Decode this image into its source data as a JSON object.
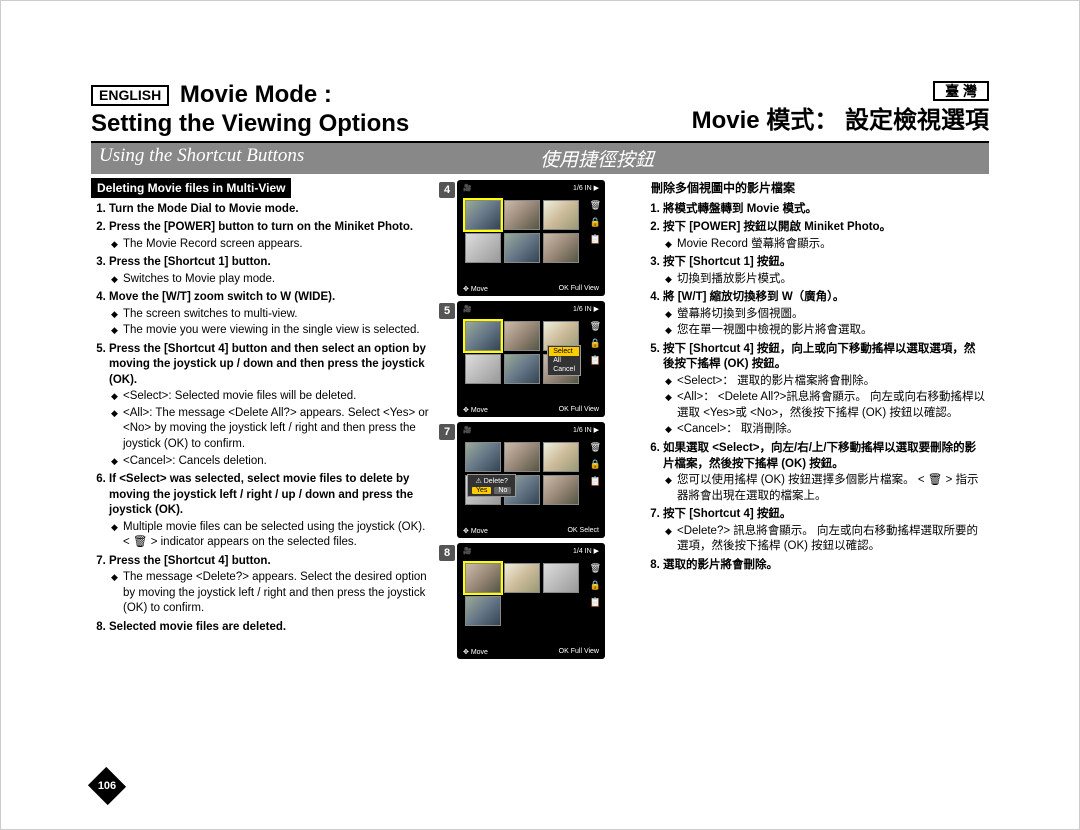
{
  "lang_badge_en": "ENGLISH",
  "lang_badge_tw": "臺 灣",
  "title_en_1": "Movie Mode :",
  "title_en_2": "Setting the Viewing Options",
  "title_zh": "Movie 模式： 設定檢視選項",
  "section_en": "Using the Shortcut Buttons",
  "section_zh": "使用捷徑按鈕",
  "subhead_en": "Deleting Movie files in Multi-View",
  "subhead_zh": "刪除多個視圖中的影片檔案",
  "page_number": "106",
  "screens": {
    "counter": "1/6",
    "media": "IN",
    "move": "Move",
    "fullview": "Full View",
    "select": "Select",
    "delete_q": "Delete?",
    "yes": "Yes",
    "no": "No",
    "popup": {
      "select": "Select",
      "all": "All",
      "cancel": "Cancel"
    }
  },
  "en": {
    "s1": "Turn the Mode Dial to Movie mode.",
    "s2": "Press the [POWER] button to turn on the Miniket Photo.",
    "s2a": "The Movie Record screen appears.",
    "s3": "Press the [Shortcut 1] button.",
    "s3a": "Switches to Movie play mode.",
    "s4": "Move the [W/T] zoom switch to W (WIDE).",
    "s4a": "The screen switches to multi-view.",
    "s4b": "The movie you were viewing in the single view is selected.",
    "s5": "Press the [Shortcut 4] button and then select an option by moving the joystick up / down and then press the joystick (OK).",
    "s5a": "<Select>: Selected movie files will be deleted.",
    "s5b": "<All>: The message <Delete All?> appears. Select <Yes> or <No> by moving the joystick left / right and then press the joystick (OK) to confirm.",
    "s5c": "<Cancel>: Cancels deletion.",
    "s6": "If <Select> was selected, select movie files to delete by moving the joystick left / right / up / down and press the joystick (OK).",
    "s6a": "Multiple movie files can be selected using the joystick (OK). < 🗑 > indicator appears on the selected files.",
    "s7": "Press the [Shortcut 4] button.",
    "s7a": "The message <Delete?> appears. Select the desired option by moving the joystick left / right and then press the joystick (OK) to confirm.",
    "s8": "Selected movie files are deleted."
  },
  "zh": {
    "s1": "將模式轉盤轉到 Movie 模式。",
    "s2": "按下 [POWER] 按鈕以開啟 Miniket Photo。",
    "s2a": "Movie Record 螢幕將會顯示。",
    "s3": "按下 [Shortcut 1] 按鈕。",
    "s3a": "切換到播放影片模式。",
    "s4": "將 [W/T] 縮放切換移到 W（廣角）。",
    "s4a": "螢幕將切換到多個視圖。",
    "s4b": "您在單一視圖中檢視的影片將會選取。",
    "s5": "按下 [Shortcut 4] 按鈕，向上或向下移動搖桿以選取選項，然後按下搖桿 (OK) 按鈕。",
    "s5a": "<Select>： 選取的影片檔案將會刪除。",
    "s5b": "<All>： <Delete All?>訊息將會顯示。 向左或向右移動搖桿以選取 <Yes>或 <No>，然後按下搖桿 (OK) 按鈕以確認。",
    "s5c": "<Cancel>： 取消刪除。",
    "s6": "如果選取 <Select>，向左/右/上/下移動搖桿以選取要刪除的影片檔案，然後按下搖桿 (OK) 按鈕。",
    "s6a": "您可以使用搖桿 (OK) 按鈕選擇多個影片檔案。 < 🗑 > 指示器將會出現在選取的檔案上。",
    "s7": "按下 [Shortcut 4] 按鈕。",
    "s7a": "<Delete?> 訊息將會顯示。 向左或向右移動搖桿選取所要的選項，然後按下搖桿 (OK) 按鈕以確認。",
    "s8": "選取的影片將會刪除。"
  }
}
